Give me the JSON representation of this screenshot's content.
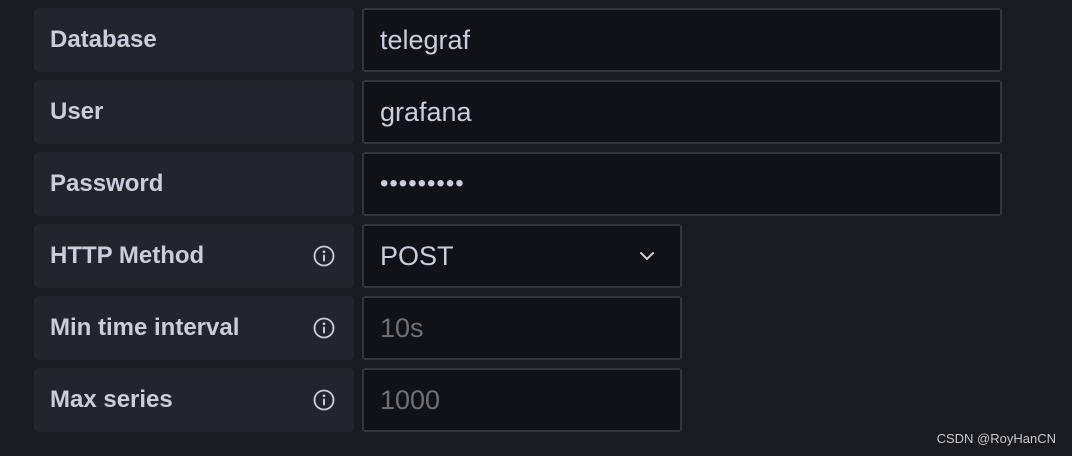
{
  "fields": {
    "database": {
      "label": "Database",
      "value": "telegraf"
    },
    "user": {
      "label": "User",
      "value": "grafana"
    },
    "password": {
      "label": "Password",
      "value": "•••••••••"
    },
    "http_method": {
      "label": "HTTP Method",
      "value": "POST",
      "icon": "info-circle-icon"
    },
    "min_time_interval": {
      "label": "Min time interval",
      "placeholder": "10s",
      "icon": "info-circle-icon"
    },
    "max_series": {
      "label": "Max series",
      "placeholder": "1000",
      "icon": "info-circle-icon"
    }
  },
  "watermark": "CSDN @RoyHanCN",
  "colors": {
    "background": "#181b1f",
    "label_bg": "#22252b",
    "input_bg": "#111217",
    "border": "#34363d",
    "text": "#ccccdc",
    "placeholder": "#6e7079"
  }
}
